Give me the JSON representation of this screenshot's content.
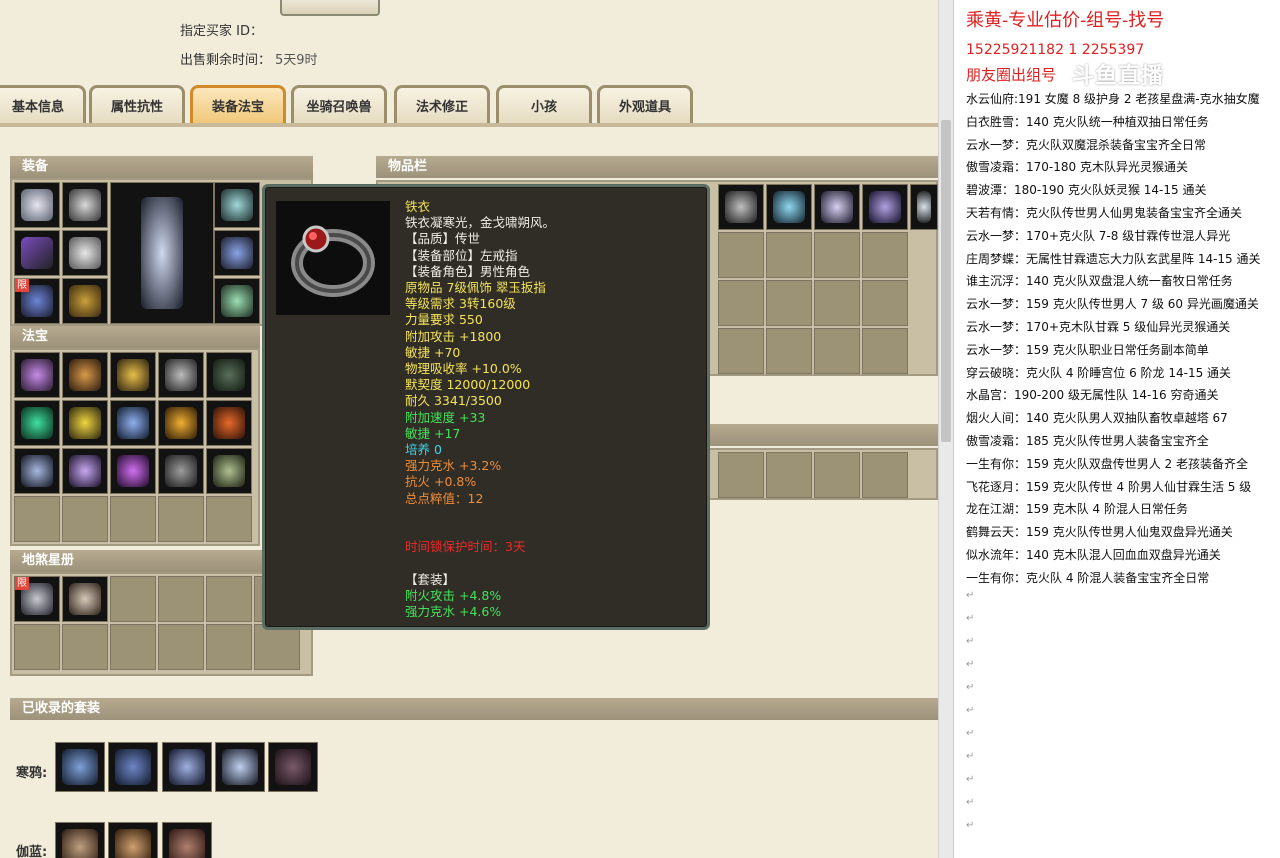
{
  "header": {
    "buyer_label": "指定买家 ID：",
    "time_label": "出售剩余时间：",
    "time_value": "5天9时"
  },
  "tabs": [
    {
      "label": "基本信息"
    },
    {
      "label": "属性抗性"
    },
    {
      "label": "装备法宝",
      "active": true
    },
    {
      "label": "坐骑召唤兽"
    },
    {
      "label": "法术修正"
    },
    {
      "label": "小孩"
    },
    {
      "label": "外观道具"
    }
  ],
  "panels": {
    "equipment": "装备",
    "inventory": "物品栏",
    "treasure": "法宝",
    "star_book": "地煞星册",
    "suits": "已收录的套装",
    "limit_badge": "限"
  },
  "suits": [
    {
      "name": "寒鸦:"
    },
    {
      "name": "伽蓝:"
    }
  ],
  "tooltip": {
    "lines": [
      {
        "text": "铁衣",
        "color": "yellow"
      },
      {
        "text": "铁衣凝寒光，金戈啸朔风。",
        "color": "white"
      },
      {
        "text": "【品质】传世",
        "color": "white"
      },
      {
        "text": "【装备部位】左戒指",
        "color": "white"
      },
      {
        "text": "【装备角色】男性角色",
        "color": "white"
      },
      {
        "text": "原物品 7级佩饰 翠玉扳指",
        "color": "yellow"
      },
      {
        "text": "等级需求 3转160级",
        "color": "yellow"
      },
      {
        "text": "力量要求 550",
        "color": "yellow"
      },
      {
        "text": "附加攻击 +1800",
        "color": "yellow"
      },
      {
        "text": "敏捷 +70",
        "color": "yellow"
      },
      {
        "text": "物理吸收率 +10.0%",
        "color": "yellow"
      },
      {
        "text": "默契度 12000/12000",
        "color": "yellow"
      },
      {
        "text": "耐久 3341/3500",
        "color": "yellow"
      },
      {
        "text": "附加速度 +33",
        "color": "green"
      },
      {
        "text": "敏捷 +17",
        "color": "green"
      },
      {
        "text": "培养 0",
        "color": "cyan"
      },
      {
        "text": "强力克水 +3.2%",
        "color": "orange"
      },
      {
        "text": "抗火 +0.8%",
        "color": "orange"
      },
      {
        "text": "总点粹值：12",
        "color": "orange"
      },
      {
        "text": "",
        "color": "white"
      },
      {
        "text": "",
        "color": "white"
      },
      {
        "text": "时间锁保护时间：3天",
        "color": "red"
      },
      {
        "text": "",
        "color": "white"
      },
      {
        "text": "【套装】",
        "color": "white"
      },
      {
        "text": "附火攻击 +4.8%",
        "color": "green"
      },
      {
        "text": "强力克水 +4.6%",
        "color": "green"
      }
    ]
  },
  "doc": {
    "title": "乘黄-专业估价-组号-找号",
    "phones": "15225921182    1  2255397",
    "circle": "朋友圈出组号",
    "watermark": "斗鱼直播",
    "items": [
      "水云仙府:191 女魔 8 级护身 2 老孩星盘满-克水抽女魔",
      "白衣胜雪：140 克火队统一种植双抽日常任务",
      "云水一梦：克火队双魔混杀装备宝宝齐全日常",
      "傲雪凌霜：170-180 克木队异光灵猴通关",
      "碧波潭：180-190 克火队妖灵猴 14-15 通关",
      "天若有情：克火队传世男人仙男鬼装备宝宝齐全通关",
      "云水一梦：170+克火队 7-8 级甘霖传世混人异光",
      "庄周梦蝶：无属性甘霖遗忘大力队玄武星阵 14-15 通关",
      "谁主沉浮：140 克火队双盘混人统一畜牧日常任务",
      "云水一梦：159 克火队传世男人 7 级 60 异光画魔通关",
      "云水一梦：170+克木队甘霖 5 级仙异光灵猴通关",
      "云水一梦：159 克火队职业日常任务副本简单",
      "穿云破晓：克火队 4 阶睡宫位 6 阶龙 14-15 通关",
      "水晶宫：190-200 级无属性队 14-16 穷奇通关",
      "烟火人间：140 克火队男人双抽队畜牧卓越塔 67",
      "傲雪凌霜：185 克火队传世男人装备宝宝齐全",
      "一生有你：159 克火队双盘传世男人 2 老孩装备齐全",
      "飞花逐月：159 克火队传世 4 阶男人仙甘霖生活 5 级",
      "龙在江湖：159 克木队 4 阶混人日常任务",
      "鹤舞云天：159 克火队传世男人仙鬼双盘异光通关",
      "似水流年：140 克木队混人回血血双盘异光通关",
      "一生有你：克火队 4 阶混人装备宝宝齐全日常"
    ]
  },
  "colors": {
    "yellow": "#f5e35a",
    "white": "#f0efe7",
    "green": "#46e25a",
    "cyan": "#3fd4ea",
    "orange": "#ef8d39",
    "red": "#ee2a2a"
  }
}
